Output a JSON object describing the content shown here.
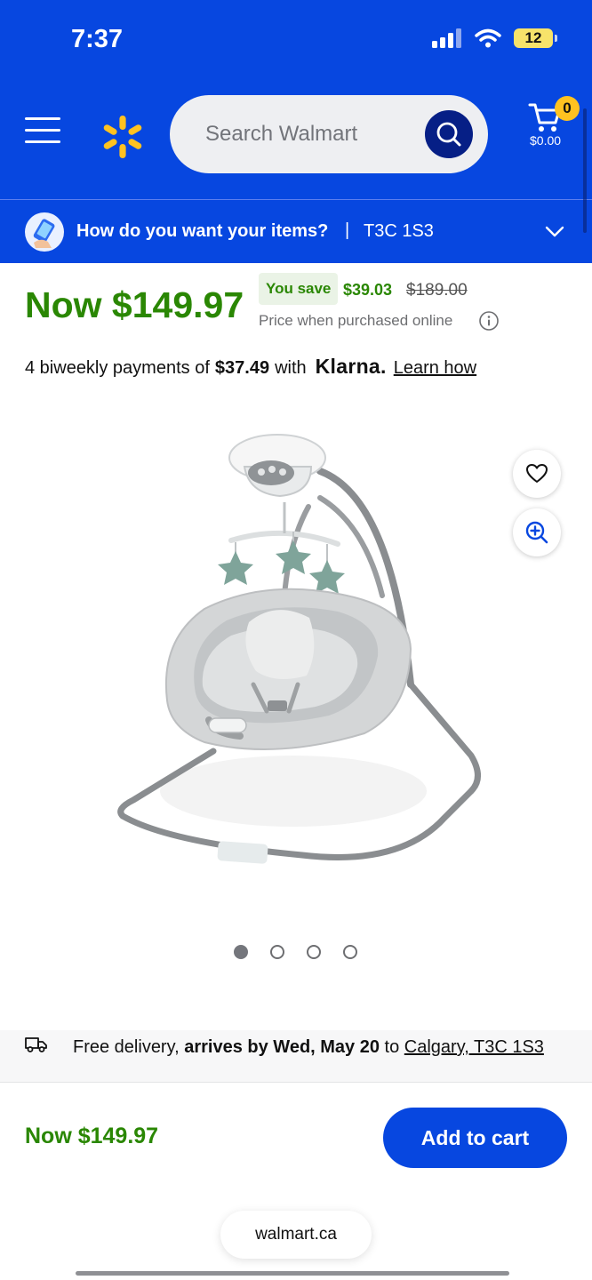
{
  "status_bar": {
    "time": "7:37",
    "battery": "12"
  },
  "header": {
    "search": {
      "placeholder": "Search Walmart"
    },
    "cart": {
      "count": "0",
      "total": "$0.00"
    }
  },
  "delivery_bar": {
    "question": "How do you want your items?",
    "separator": "|",
    "postal_code": "T3C 1S3"
  },
  "pricing": {
    "now": "Now $149.97",
    "you_save_label": "You save",
    "save_amount": "$39.03",
    "was_price": "$189.00",
    "note": "Price when purchased online"
  },
  "klarna": {
    "prefix": "4 biweekly payments of",
    "amount": "$37.49",
    "with": "with",
    "brand": "Klarna.",
    "learn_how": "Learn how"
  },
  "carousel": {
    "total": 4,
    "active": 0
  },
  "delivery_info": {
    "free_delivery": "Free delivery,",
    "arrives": "arrives by Wed, May 20",
    "to": "to",
    "location": "Calgary, T3C 1S3"
  },
  "bottom_bar": {
    "price": "Now $149.97",
    "add_to_cart": "Add to cart"
  },
  "browser": {
    "url": "walmart.ca"
  },
  "colors": {
    "walmart_blue": "#0747e0",
    "spark_yellow": "#ffc220",
    "price_green": "#2a8703",
    "dark_blue": "#061f86"
  }
}
